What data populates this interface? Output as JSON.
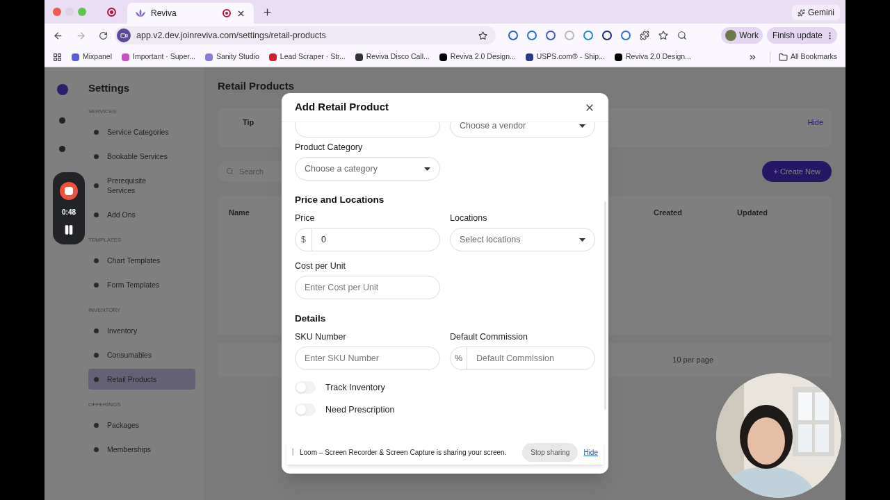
{
  "browser": {
    "tabs": [
      {
        "title": "Reviva",
        "selected": true
      }
    ],
    "gemini": "Gemini",
    "url": "app.v2.dev.joinreviva.com/settings/retail-products",
    "profile": "Work",
    "update_button": "Finish update",
    "bookmarks": [
      {
        "label": "Mixpanel"
      },
      {
        "label": "Important · Super..."
      },
      {
        "label": "Sanity Studio"
      },
      {
        "label": "Lead Scraper · Str..."
      },
      {
        "label": "Reviva Disco Call..."
      },
      {
        "label": "Reviva 2.0 Design..."
      },
      {
        "label": "USPS.com® - Ship..."
      },
      {
        "label": "Reviva 2.0 Design..."
      }
    ],
    "all_bookmarks": "All Bookmarks"
  },
  "app": {
    "sidebar": {
      "title": "Settings",
      "sections": [
        {
          "heading": "SERVICES",
          "items": [
            {
              "label": "Service Categories",
              "selected": false
            },
            {
              "label": "Bookable Services",
              "selected": false
            },
            {
              "label": "Prerequisite Services",
              "selected": false
            },
            {
              "label": "Add Ons",
              "selected": false
            }
          ]
        },
        {
          "heading": "TEMPLATES",
          "items": [
            {
              "label": "Chart Templates",
              "selected": false
            },
            {
              "label": "Form Templates",
              "selected": false
            }
          ]
        },
        {
          "heading": "INVENTORY",
          "items": [
            {
              "label": "Inventory",
              "selected": false
            },
            {
              "label": "Consumables",
              "selected": false
            },
            {
              "label": "Retail Products",
              "selected": true
            }
          ]
        },
        {
          "heading": "OFFERINGS",
          "items": [
            {
              "label": "Packages",
              "selected": false
            },
            {
              "label": "Memberships",
              "selected": false
            }
          ]
        }
      ]
    },
    "page_title": "Retail Products",
    "tip": {
      "title": "Tip",
      "action": "Hide"
    },
    "search": {
      "placeholder": "Search"
    },
    "create_button": "+ Create New",
    "table": {
      "columns": [
        "Name",
        "Created",
        "Updated"
      ]
    },
    "pagination": "10 per page"
  },
  "modal": {
    "title": "Add Retail Product",
    "top_row": [
      {
        "kind": "input"
      },
      {
        "kind": "select",
        "placeholder": "Choose a vendor"
      }
    ],
    "sections": [
      {
        "fields": [
          {
            "kind": "select",
            "label": "Product Category",
            "placeholder": "Choose a category"
          }
        ]
      },
      {
        "heading": "Price and Locations",
        "fields": [
          {
            "kind": "prefixed",
            "label": "Price",
            "prefix": "$",
            "value": "0"
          },
          {
            "kind": "select",
            "label": "Locations",
            "placeholder": "Select locations"
          },
          {
            "kind": "input",
            "label": "Cost per Unit",
            "placeholder": "Enter Cost per Unit"
          }
        ]
      },
      {
        "heading": "Details",
        "fields": [
          {
            "kind": "input",
            "label": "SKU Number",
            "placeholder": "Enter SKU Number"
          },
          {
            "kind": "prefixed",
            "label": "Default Commission",
            "prefix": "%",
            "placeholder": "Default Commission"
          }
        ],
        "toggles": [
          {
            "label": "Track Inventory",
            "on": false
          },
          {
            "label": "Need Prescription",
            "on": false
          }
        ]
      }
    ]
  },
  "loom": {
    "timer": "0:48",
    "banner": "Loom – Screen Recorder & Screen Capture is sharing your screen.",
    "stop_button": "Stop sharing",
    "hide_link": "Hide"
  }
}
